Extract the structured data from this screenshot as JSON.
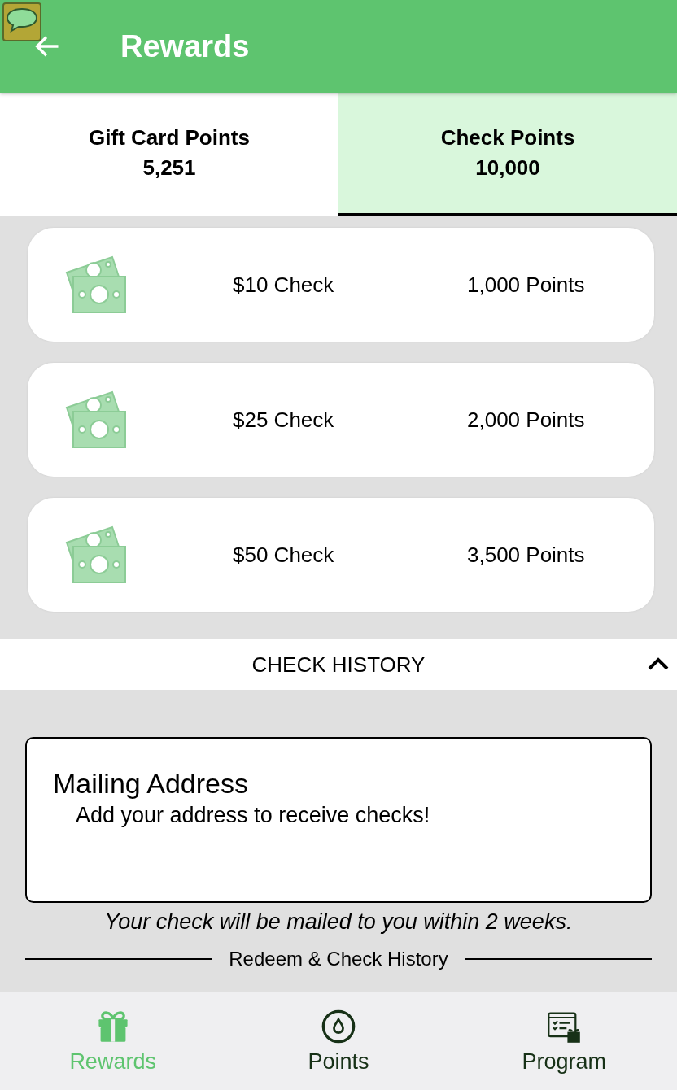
{
  "app_bar": {
    "title": "Rewards"
  },
  "tabs": [
    {
      "label": "Gift Card Points",
      "value": "5,251",
      "selected": false
    },
    {
      "label": "Check Points",
      "value": "10,000",
      "selected": true
    }
  ],
  "rewards": [
    {
      "name": "$10 Check",
      "points": "1,000 Points"
    },
    {
      "name": "$25 Check",
      "points": "2,000 Points"
    },
    {
      "name": "$50 Check",
      "points": "3,500 Points"
    }
  ],
  "check_history": {
    "label": "CHECK HISTORY",
    "expanded": true
  },
  "mailing_address": {
    "title": "Mailing Address",
    "text": "Add your address to receive checks!"
  },
  "note": "Your check will be mailed to you within 2 weeks.",
  "history_heading": "Redeem & Check History",
  "bottom_nav": [
    {
      "label": "Rewards",
      "selected": true
    },
    {
      "label": "Points",
      "selected": false
    },
    {
      "label": "Program",
      "selected": false
    }
  ]
}
